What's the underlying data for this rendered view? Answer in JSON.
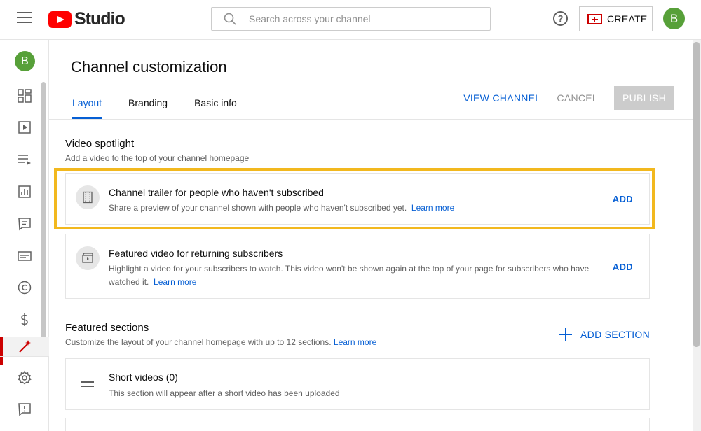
{
  "header": {
    "brand": "Studio",
    "search_placeholder": "Search across your channel",
    "create_label": "CREATE",
    "avatar_letter": "B"
  },
  "sidebar": {
    "avatar_letter": "B"
  },
  "page": {
    "title": "Channel customization",
    "tabs": [
      {
        "label": "Layout",
        "active": true
      },
      {
        "label": "Branding",
        "active": false
      },
      {
        "label": "Basic info",
        "active": false
      }
    ],
    "actions": {
      "view_channel": "VIEW CHANNEL",
      "cancel": "CANCEL",
      "publish": "PUBLISH"
    }
  },
  "video_spotlight": {
    "title": "Video spotlight",
    "subtitle": "Add a video to the top of your channel homepage",
    "cards": [
      {
        "title": "Channel trailer for people who haven't subscribed",
        "description": "Share a preview of your channel shown with people who haven't subscribed yet.",
        "link": "Learn more",
        "action": "ADD"
      },
      {
        "title": "Featured video for returning subscribers",
        "description": "Highlight a video for your subscribers to watch. This video won't be shown again at the top of your page for subscribers who have watched it.",
        "link": "Learn more",
        "action": "ADD"
      }
    ]
  },
  "featured_sections": {
    "title": "Featured sections",
    "subtitle": "Customize the layout of your channel homepage with up to 12 sections.",
    "link": "Learn more",
    "add_label": "ADD SECTION",
    "items": [
      {
        "title": "Short videos",
        "count": "(0)",
        "description": "This section will appear after a short video has been uploaded"
      }
    ]
  },
  "colors": {
    "accent": "#065fd4",
    "brand_red": "#ff0000",
    "highlight": "#f2b81e",
    "avatar": "#57a039"
  }
}
